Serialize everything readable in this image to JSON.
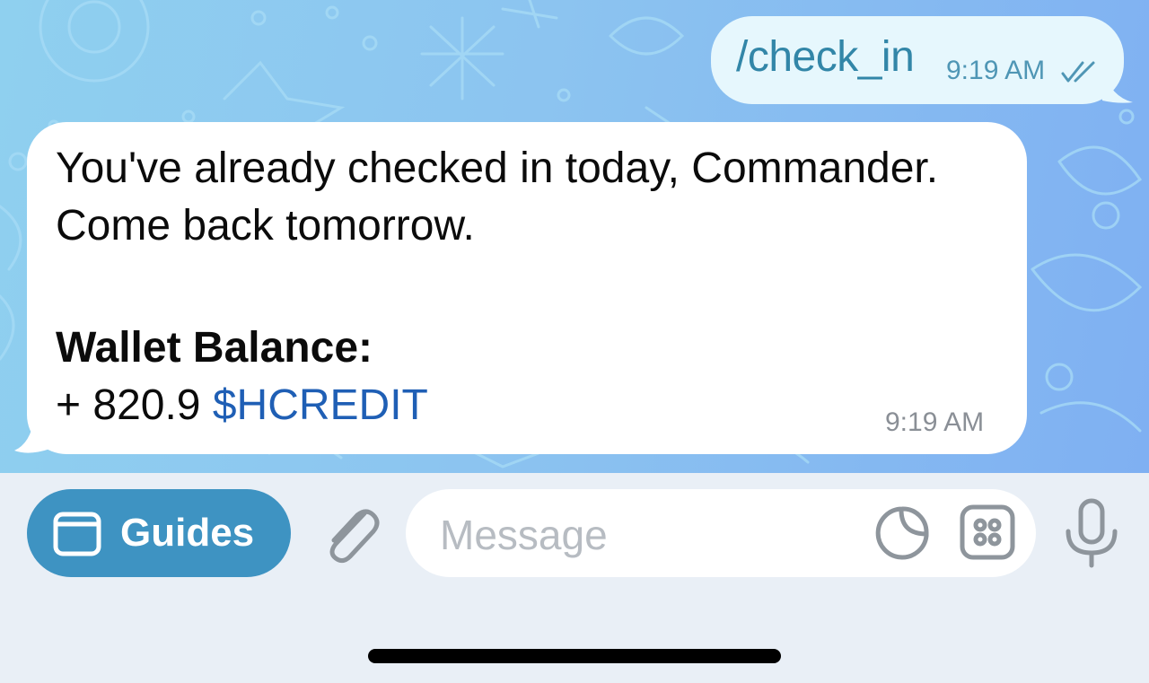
{
  "messages": {
    "outgoing": {
      "text": "/check_in",
      "time": "9:19 AM",
      "status_icon": "double-check-icon"
    },
    "incoming": {
      "line1": "You've already checked in today, Commander.",
      "line2": "Come back tomorrow.",
      "balance_label": "Wallet Balance:",
      "balance_amount": "+ 820.9",
      "balance_currency": "$HCREDIT",
      "time": "9:19 AM"
    }
  },
  "input_bar": {
    "guides_label": "Guides",
    "message_placeholder": "Message",
    "icons": [
      "web-app-icon",
      "attach-icon",
      "sticker-icon",
      "apps-icon",
      "microphone-icon"
    ]
  },
  "colors": {
    "chat_background": "#8cc4f0",
    "outgoing_bubble": "#e6f7fd",
    "incoming_bubble": "#ffffff",
    "accent": "#3e93c2",
    "link": "#1f5fb5"
  }
}
